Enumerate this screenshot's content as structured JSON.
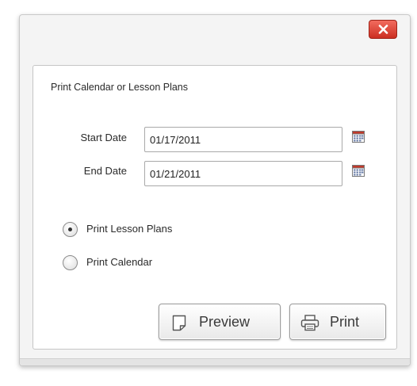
{
  "dialog": {
    "close_icon": "close-icon",
    "close_color": "#d63a2d"
  },
  "panel": {
    "title": "Print Calendar or Lesson Plans"
  },
  "start_date": {
    "label": "Start Date",
    "value": "01/17/2011",
    "icon": "calendar-icon"
  },
  "end_date": {
    "label": "End Date",
    "value": "01/21/2011",
    "icon": "calendar-icon"
  },
  "options": [
    {
      "label": "Print Lesson Plans",
      "selected": true
    },
    {
      "label": "Print Calendar",
      "selected": false
    }
  ],
  "buttons": {
    "preview_label": "Preview",
    "preview_icon": "document-icon",
    "print_label": "Print",
    "print_icon": "printer-icon"
  }
}
